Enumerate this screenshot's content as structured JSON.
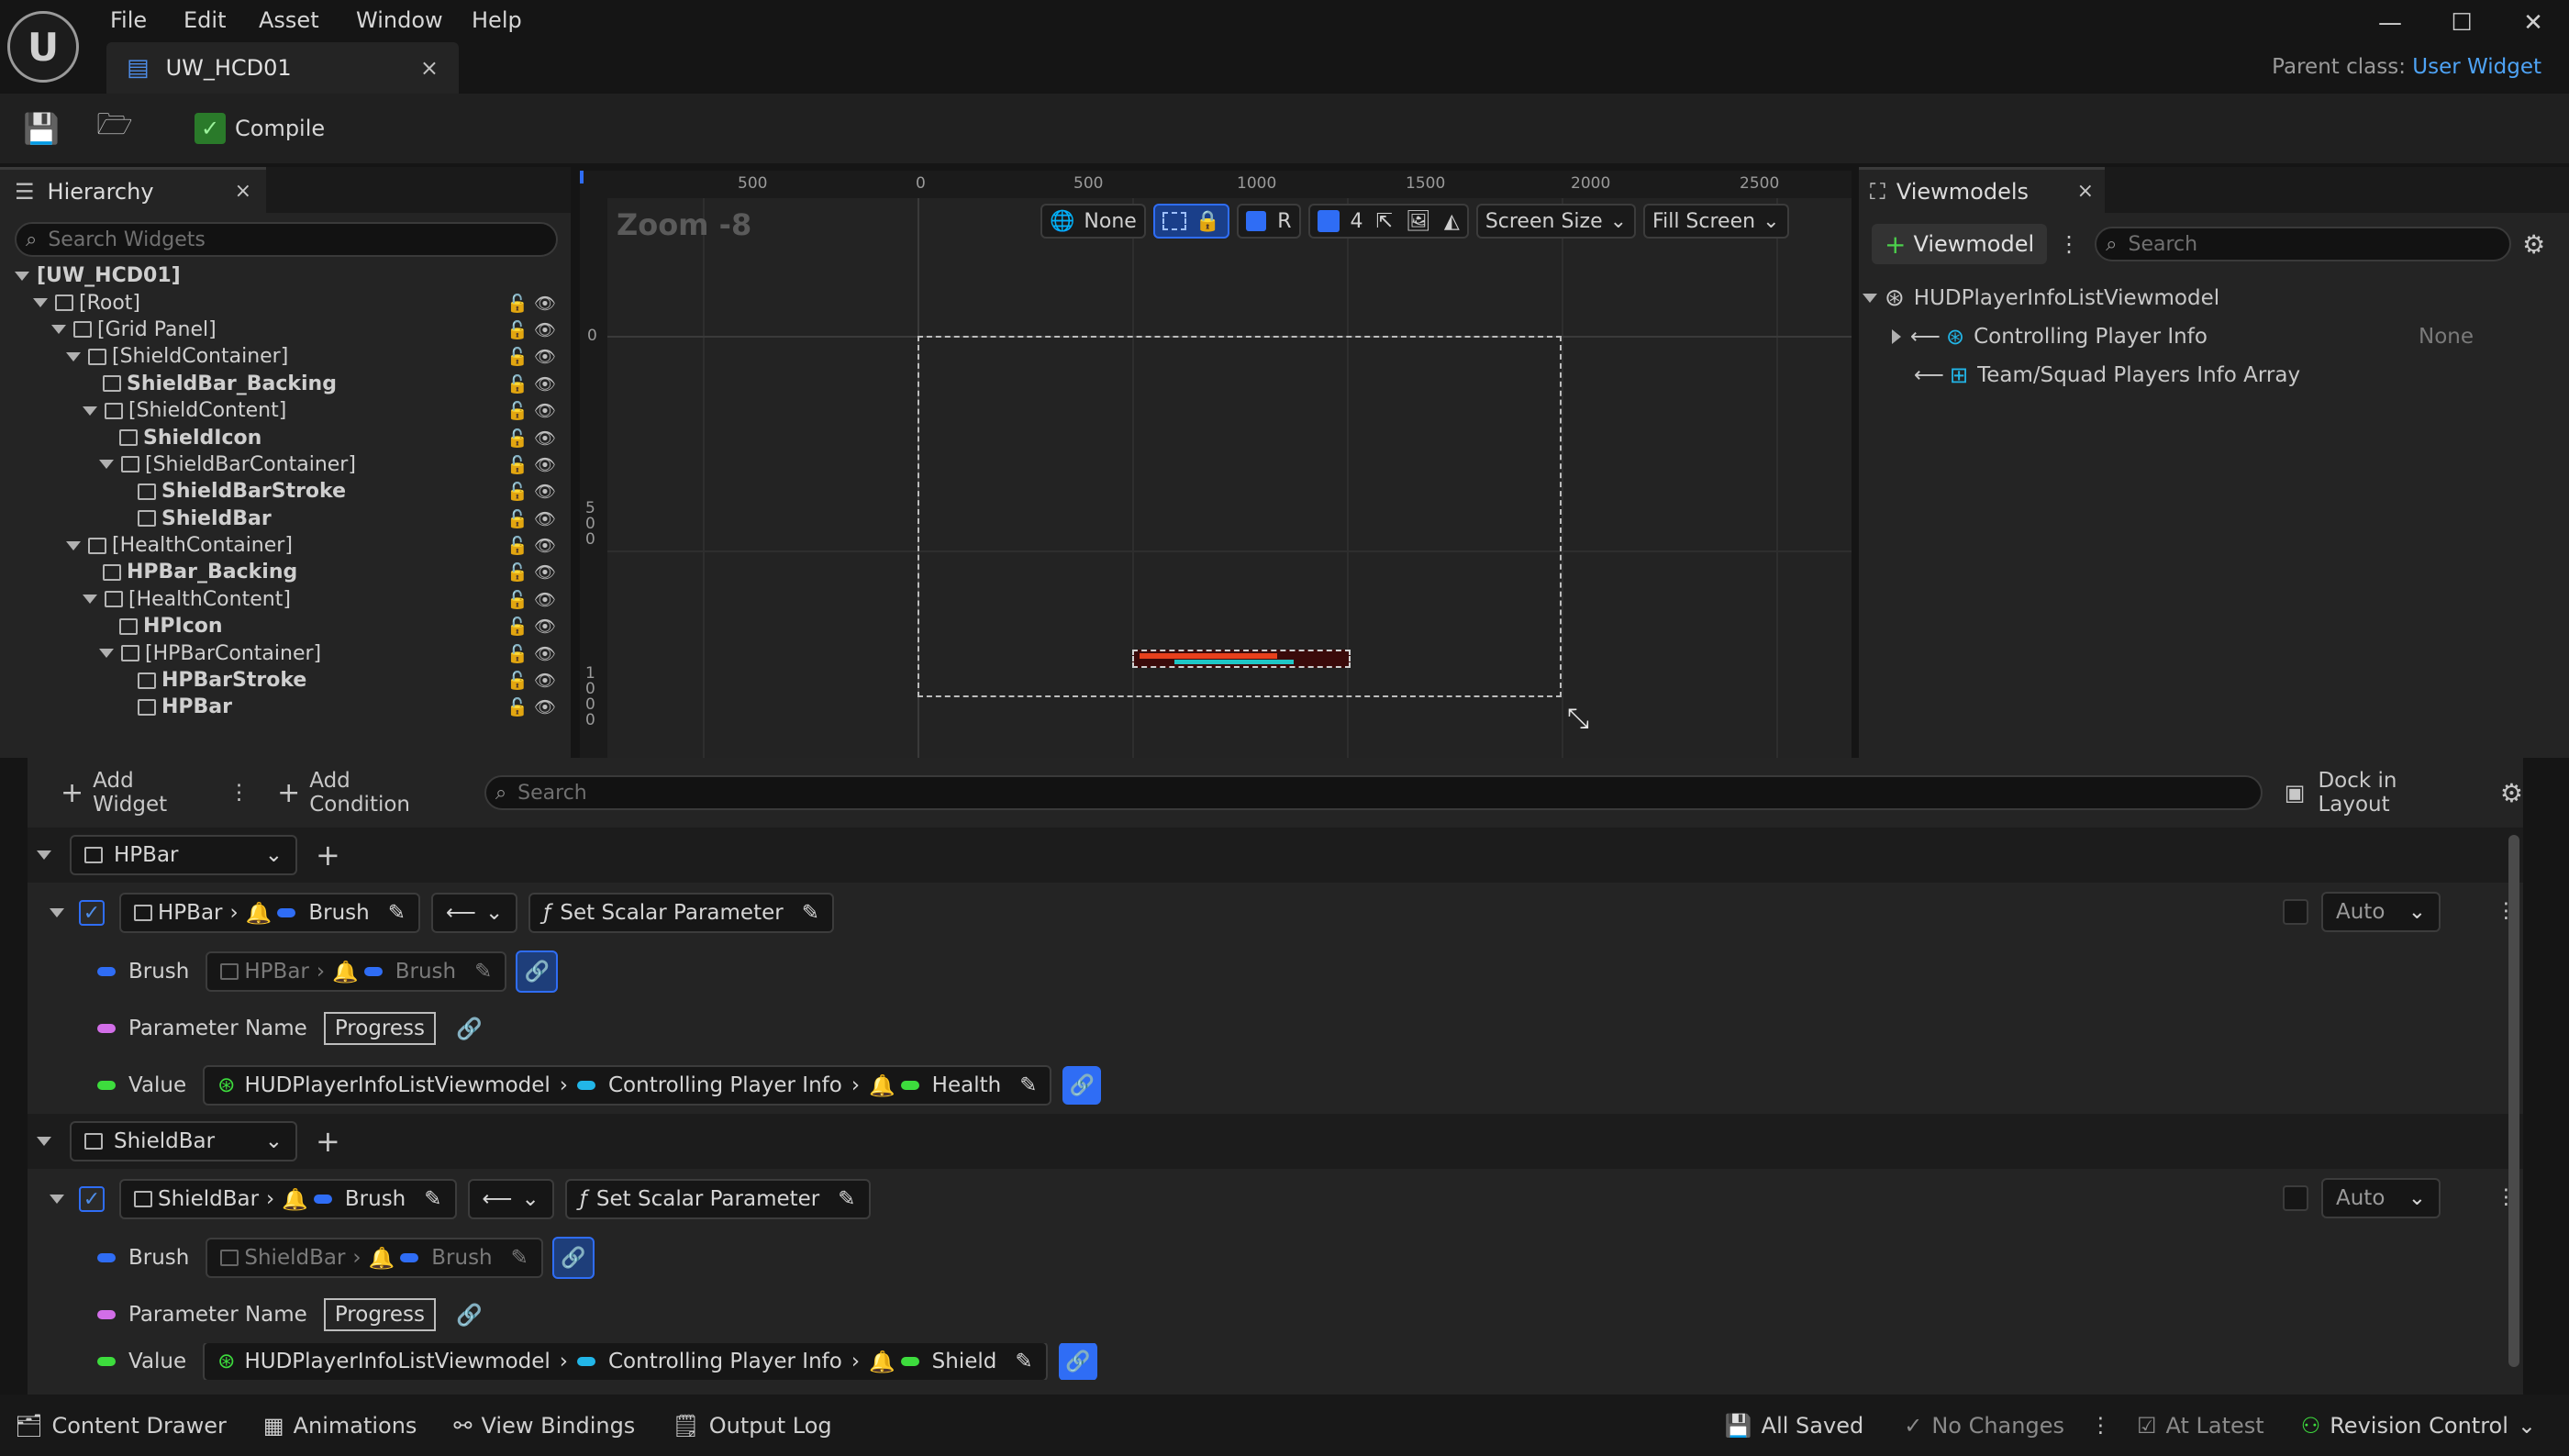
{
  "titlebar": {
    "menus": [
      "File",
      "Edit",
      "Asset",
      "Window",
      "Help"
    ],
    "doc_tab": "UW_HCD01",
    "parent_class_label": "Parent class:",
    "parent_class_value": "User Widget"
  },
  "toolbar": {
    "compile_label": "Compile"
  },
  "hierarchy": {
    "tab_label": "Hierarchy",
    "search_placeholder": "Search Widgets",
    "items": [
      {
        "label": "[UW_HCD01]"
      },
      {
        "label": "[Root]"
      },
      {
        "label": "[Grid Panel]"
      },
      {
        "label": "[ShieldContainer]"
      },
      {
        "label": "ShieldBar_Backing"
      },
      {
        "label": "[ShieldContent]"
      },
      {
        "label": "ShieldIcon"
      },
      {
        "label": "[ShieldBarContainer]"
      },
      {
        "label": "ShieldBarStroke"
      },
      {
        "label": "ShieldBar"
      },
      {
        "label": "[HealthContainer]"
      },
      {
        "label": "HPBar_Backing"
      },
      {
        "label": "[HealthContent]"
      },
      {
        "label": "HPIcon"
      },
      {
        "label": "[HPBarContainer]"
      },
      {
        "label": "HPBarStroke"
      },
      {
        "label": "HPBar"
      }
    ]
  },
  "viewport": {
    "zoom_label": "Zoom -8",
    "ruler_top": [
      "500",
      "0",
      "500",
      "1000",
      "1500",
      "2000",
      "2500"
    ],
    "ruler_left": [
      "0",
      "500",
      "1000"
    ],
    "none_label": "None",
    "r_label": "R",
    "grid_count": "4",
    "screen_size_label": "Screen Size",
    "fill_screen_label": "Fill Screen"
  },
  "viewmodels": {
    "tab_label": "Viewmodels",
    "add_label": "Viewmodel",
    "search_placeholder": "Search",
    "root": "HUDPlayerInfoListViewmodel",
    "children": [
      {
        "label": "Controlling Player Info",
        "value": "None"
      },
      {
        "label": "Team/Squad Players Info Array",
        "value": ""
      }
    ]
  },
  "bindings": {
    "add_widget_label": "Add Widget",
    "add_condition_label": "Add Condition",
    "search_placeholder": "Search",
    "dock_label": "Dock in Layout",
    "groups": [
      {
        "widget": "HPBar",
        "target_widget": "HPBar",
        "target_prop": "Brush",
        "function": "Set Scalar Parameter",
        "mode": "Auto",
        "brush_label": "Brush",
        "brush_widget": "HPBar",
        "brush_prop": "Brush",
        "param_label": "Parameter Name",
        "param_value": "Progress",
        "value_label": "Value",
        "value_vm": "HUDPlayerInfoListViewmodel",
        "value_prop": "Controlling Player Info",
        "value_field": "Health"
      },
      {
        "widget": "ShieldBar",
        "target_widget": "ShieldBar",
        "target_prop": "Brush",
        "function": "Set Scalar Parameter",
        "mode": "Auto",
        "brush_label": "Brush",
        "brush_widget": "ShieldBar",
        "brush_prop": "Brush",
        "param_label": "Parameter Name",
        "param_value": "Progress",
        "value_label": "Value",
        "value_vm": "HUDPlayerInfoListViewmodel",
        "value_prop": "Controlling Player Info",
        "value_field": "Shield"
      }
    ]
  },
  "statusbar": {
    "content_drawer": "Content Drawer",
    "animations": "Animations",
    "view_bindings": "View Bindings",
    "output_log": "Output Log",
    "all_saved": "All Saved",
    "no_changes": "No Changes",
    "at_latest": "At Latest",
    "revision_control": "Revision Control"
  },
  "colors": {
    "accent_blue": "#2f6df5",
    "link_blue": "#4ea3f5",
    "hp_bar": "#e8401c",
    "shield_bar": "#1fc6c6"
  }
}
